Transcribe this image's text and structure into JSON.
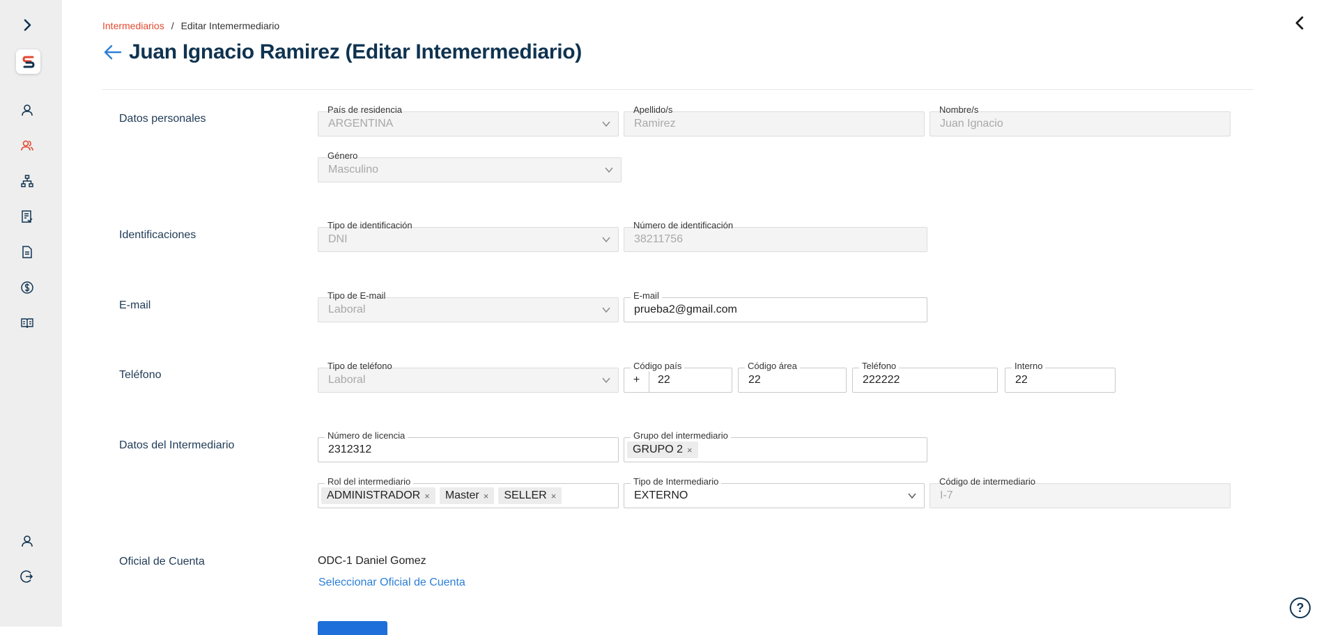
{
  "sidebar": {
    "expand_icon": "chevron-right-icon",
    "logo_letter": "S",
    "items": [
      {
        "name": "user-icon"
      },
      {
        "name": "users-icon",
        "active": true
      },
      {
        "name": "org-chart-icon"
      },
      {
        "name": "document-check-icon"
      },
      {
        "name": "document-icon"
      },
      {
        "name": "dollar-icon"
      },
      {
        "name": "book-icon"
      }
    ],
    "bottom": [
      {
        "name": "profile-icon"
      },
      {
        "name": "logout-icon"
      }
    ]
  },
  "breadcrumb": {
    "link": "Intermediarios",
    "separator": "/",
    "current": "Editar Intemermediario"
  },
  "page_title": "Juan Ignacio Ramirez (Editar Intemermediario)",
  "sections": {
    "personal": "Datos personales",
    "ids": "Identificaciones",
    "email": "E-mail",
    "phone": "Teléfono",
    "intermediary": "Datos del Intermediario",
    "account_officer": "Oficial de Cuenta"
  },
  "fields": {
    "pais_label": "País de residencia",
    "pais_value": "ARGENTINA",
    "apellido_label": "Apellido/s",
    "apellido_value": "Ramirez",
    "nombre_label": "Nombre/s",
    "nombre_value": "Juan Ignacio",
    "genero_label": "Género",
    "genero_value": "Masculino",
    "tipo_id_label": "Tipo de identificación",
    "tipo_id_value": "DNI",
    "num_id_label": "Número de identificación",
    "num_id_value": "38211756",
    "tipo_email_label": "Tipo de E-mail",
    "tipo_email_value": "Laboral",
    "email_label": "E-mail",
    "email_value": "prueba2@gmail.com",
    "tipo_tel_label": "Tipo de teléfono",
    "tipo_tel_value": "Laboral",
    "cod_pais_label": "Código país",
    "cod_pais_prefix": "+",
    "cod_pais_value": "22",
    "cod_area_label": "Código área",
    "cod_area_value": "22",
    "telefono_label": "Teléfono",
    "telefono_value": "222222",
    "interno_label": "Interno",
    "interno_value": "22",
    "licencia_label": "Número de licencia",
    "licencia_value": "2312312",
    "grupo_label": "Grupo del intermediario",
    "grupo_chips": [
      "GRUPO 2"
    ],
    "rol_label": "Rol del intermediario",
    "rol_chips": [
      "ADMINISTRADOR",
      "Master",
      "SELLER"
    ],
    "tipo_inter_label": "Tipo de Intermediario",
    "tipo_inter_value": "EXTERNO",
    "codigo_inter_label": "Código de intermediario",
    "codigo_inter_value": "I-7"
  },
  "account_officer": {
    "value": "ODC-1 Daniel Gomez",
    "select_link": "Seleccionar Oficial de Cuenta"
  },
  "help_label": "?",
  "chip_remove": "×",
  "colors": {
    "accent_red": "#e2492f",
    "title_navy": "#0f3350",
    "link_blue": "#2b7fd6",
    "sidebar_bg": "#eeeeee"
  }
}
